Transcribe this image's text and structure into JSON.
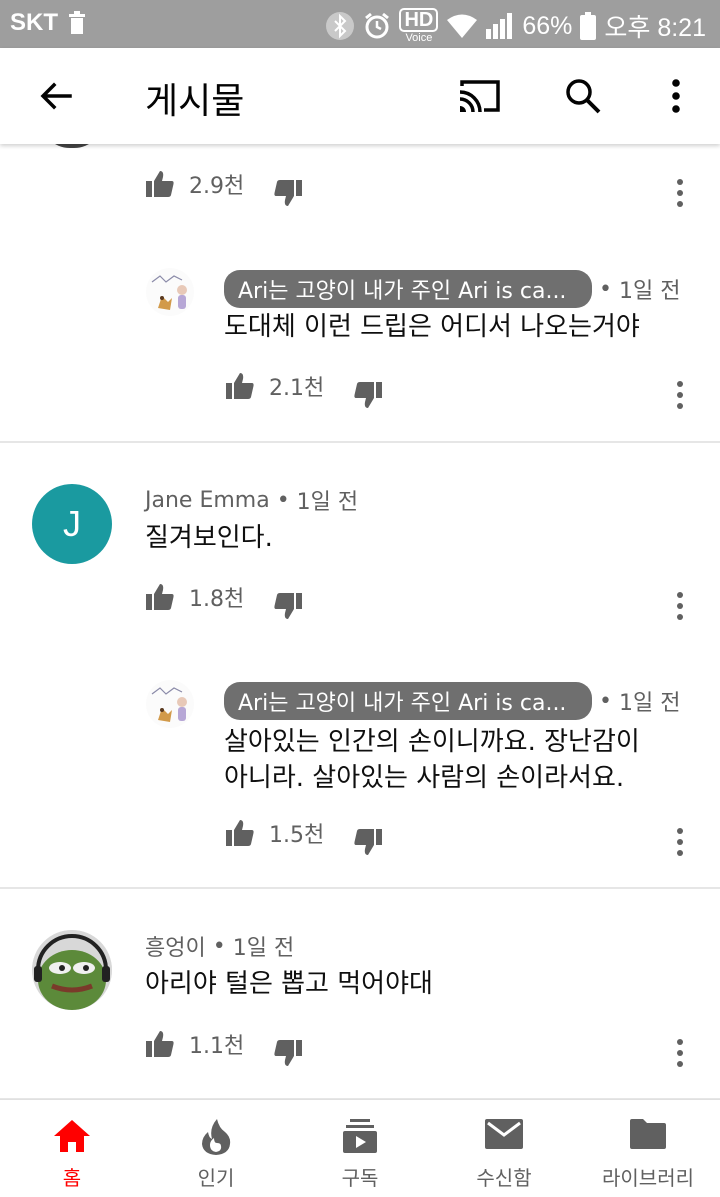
{
  "status_bar": {
    "carrier": "SKT",
    "hd": "HD",
    "voice": "Voice",
    "battery": "66%",
    "time": "오후 8:21"
  },
  "app_bar": {
    "title": "게시물"
  },
  "comments": [
    {
      "likes": "2.9천"
    },
    {
      "author": "Ari는 고양이 내가 주인  Ari is ca...",
      "time": "1일 전",
      "text": "도대체 이런 드립은 어디서 나오는거야",
      "likes": "2.1천"
    },
    {
      "author": "Jane Emma",
      "avatar_letter": "J",
      "time": "1일 전",
      "text": "질겨보인다.",
      "likes": "1.8천"
    },
    {
      "author": "Ari는 고양이 내가 주인  Ari is ca...",
      "time": "1일 전",
      "text_line1": "살아있는 인간의 손이니까요. 장난감이",
      "text_line2": "아니라. 살아있는 사람의 손이라서요.",
      "likes": "1.5천"
    },
    {
      "author": "흥엉이",
      "time": "1일 전",
      "text": "아리야 털은 뽑고 먹어야대",
      "likes": "1.1천"
    }
  ],
  "separator": "•",
  "bottom_nav": [
    {
      "label": "홈",
      "icon": "home-icon",
      "active": true
    },
    {
      "label": "인기",
      "icon": "trending-flame-icon"
    },
    {
      "label": "구독",
      "icon": "subscriptions-icon"
    },
    {
      "label": "수신함",
      "icon": "inbox-mail-icon"
    },
    {
      "label": "라이브러리",
      "icon": "library-folder-icon"
    }
  ],
  "colors": {
    "accent": "#ff0000",
    "status_bar": "#9e9e9e",
    "avatar_j": "#1a9aa0",
    "chip": "#6f6f6f",
    "icon_gray": "#606060"
  }
}
